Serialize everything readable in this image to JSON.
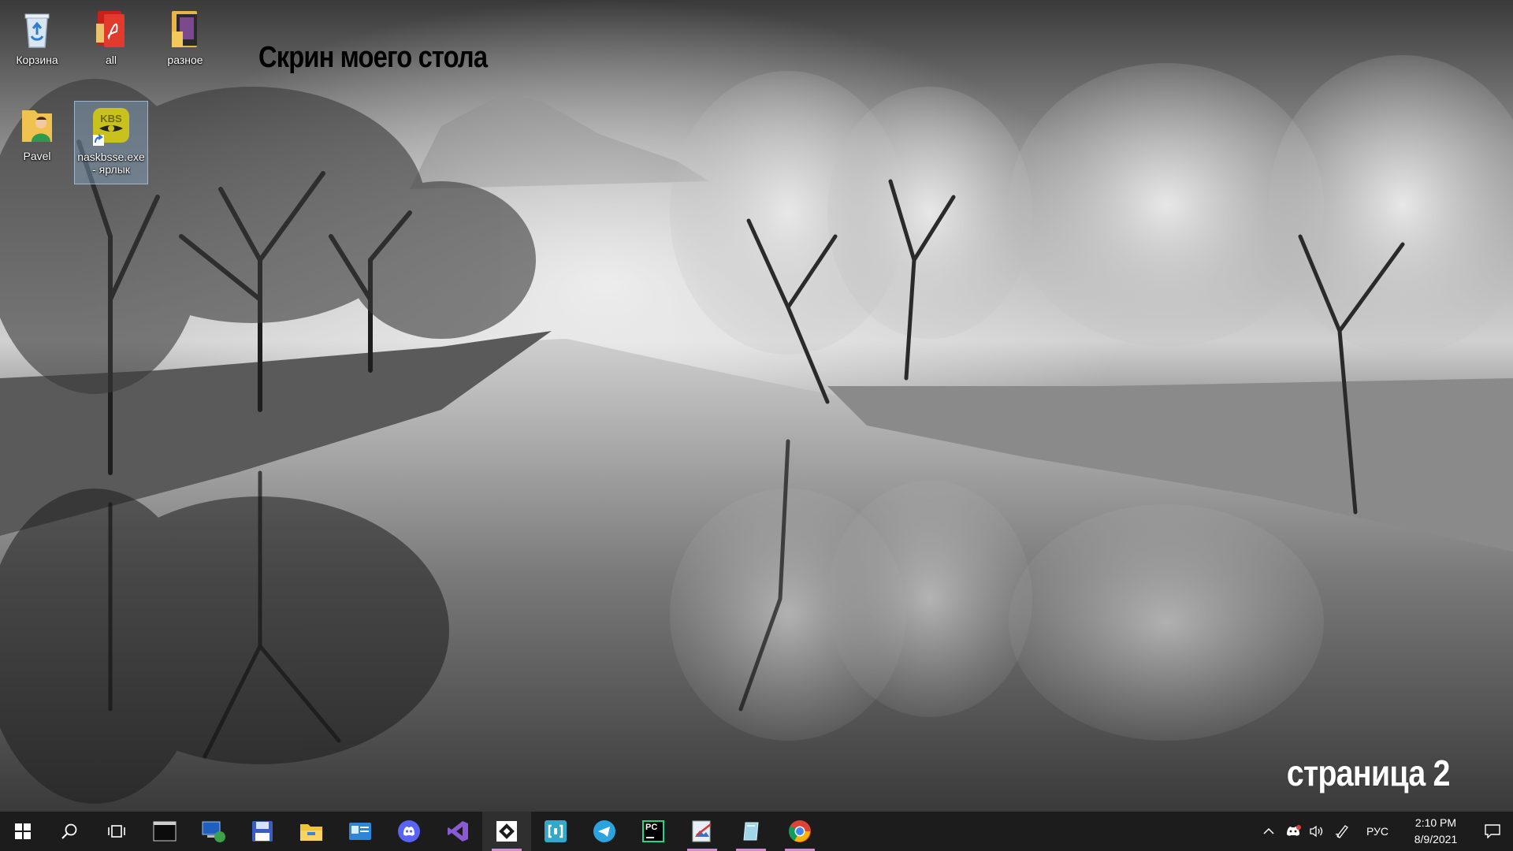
{
  "desktop": {
    "overlay_title": "Скрин моего стола",
    "page_label": "страница 2",
    "icons": [
      {
        "label": "Корзина",
        "icon": "recycle-bin-icon"
      },
      {
        "label": "all",
        "icon": "pdf-folder-icon"
      },
      {
        "label": "разное",
        "icon": "folder-icon"
      },
      {
        "label": "Pavel",
        "icon": "user-folder-icon"
      },
      {
        "label": "naskbsse.exe - ярлык",
        "icon": "kbs-shortcut-icon"
      }
    ]
  },
  "taskbar": {
    "apps": [
      {
        "name": "terminal",
        "icon": "terminal-icon"
      },
      {
        "name": "network-app",
        "icon": "network-computer-icon"
      },
      {
        "name": "save-app",
        "icon": "floppy-disk-icon"
      },
      {
        "name": "file-explorer",
        "icon": "folder-icon"
      },
      {
        "name": "contacts-app",
        "icon": "contact-card-icon"
      },
      {
        "name": "discord",
        "icon": "discord-icon"
      },
      {
        "name": "visual-studio",
        "icon": "visual-studio-icon"
      },
      {
        "name": "git-app",
        "icon": "diamond-icon"
      },
      {
        "name": "bracket-app",
        "icon": "bracket-icon"
      },
      {
        "name": "telegram",
        "icon": "telegram-icon"
      },
      {
        "name": "pycharm",
        "icon": "pycharm-icon",
        "text": "PC"
      },
      {
        "name": "image-editor",
        "icon": "image-editor-icon"
      },
      {
        "name": "notes-app",
        "icon": "glass-panel-icon"
      },
      {
        "name": "chrome",
        "icon": "chrome-icon"
      }
    ],
    "tray": {
      "language": "РУС",
      "time": "2:10 PM",
      "date": "8/9/2021"
    }
  }
}
